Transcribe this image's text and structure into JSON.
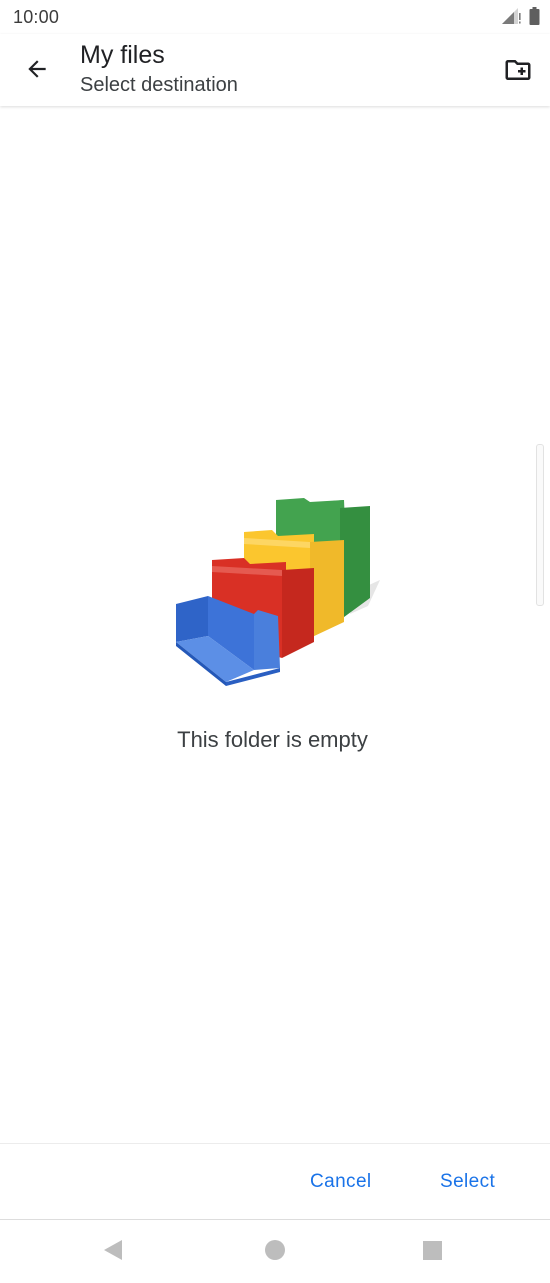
{
  "status_bar": {
    "time": "10:00",
    "icons": [
      "signal-icon",
      "battery-icon"
    ]
  },
  "app_bar": {
    "title": "My files",
    "subtitle": "Select destination",
    "back_icon": "arrow-back-icon",
    "new_folder_icon": "create-new-folder-icon"
  },
  "empty_state": {
    "illustration": "colored-folders-illustration",
    "message": "This folder is empty"
  },
  "actions": {
    "cancel_label": "Cancel",
    "select_label": "Select"
  },
  "navigation_bar": {
    "buttons": [
      "nav-back-icon",
      "nav-home-icon",
      "nav-recents-icon"
    ]
  },
  "colors": {
    "accent": "#1a73e8",
    "folder_blue": "#4a7fdc",
    "folder_red": "#d93025",
    "folder_yellow": "#fbc62e",
    "folder_green": "#3a9c48"
  }
}
